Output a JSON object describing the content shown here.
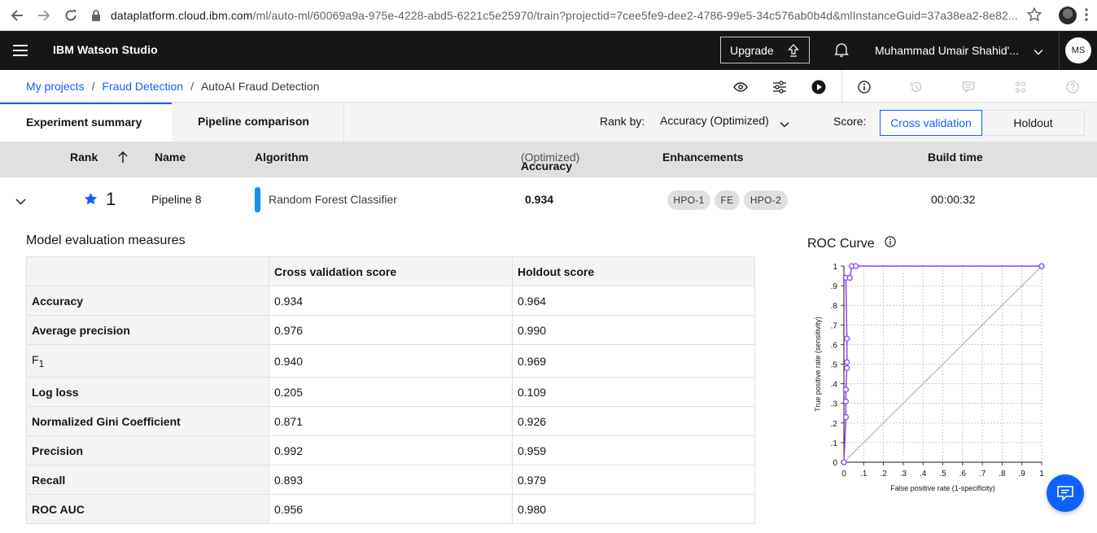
{
  "browser": {
    "url_host": "dataplatform.cloud.ibm.com",
    "url_path": "/ml/auto-ml/60069a9a-975e-4228-abd5-6221c5e25970/train?projectid=7cee5fe9-dee2-4786-99e5-34c576ab0b4d&mlInstanceGuid=37a38ea2-8e82..."
  },
  "header": {
    "product": "IBM Watson Studio",
    "upgrade_label": "Upgrade",
    "user_name": "Muhammad Umair Shahid'...",
    "avatar_initials": "MS"
  },
  "breadcrumb": {
    "items": [
      "My projects",
      "Fraud Detection"
    ],
    "current": "AutoAI Fraud Detection",
    "separator": "/"
  },
  "tabs": {
    "active": "Experiment summary",
    "inactive": "Pipeline comparison"
  },
  "rank_by": {
    "label": "Rank by:",
    "value": "Accuracy (Optimized)"
  },
  "score": {
    "label": "Score:",
    "options": [
      "Cross validation",
      "Holdout"
    ],
    "selected": "Cross validation"
  },
  "columns": {
    "rank": "Rank",
    "name": "Name",
    "algorithm": "Algorithm",
    "metric": "Accuracy",
    "metric_note": "(Optimized)",
    "enhancements": "Enhancements",
    "build_time": "Build time"
  },
  "pipeline": {
    "rank": "1",
    "name": "Pipeline 8",
    "algorithm": "Random Forest Classifier",
    "accuracy": "0.934",
    "enhancements": [
      "HPO-1",
      "FE",
      "HPO-2"
    ],
    "build_time": "00:00:32",
    "accent_color": "#1192e8"
  },
  "evaluation": {
    "title": "Model evaluation measures",
    "headers": [
      "Cross validation score",
      "Holdout score"
    ],
    "rows": [
      {
        "metric": "Accuracy",
        "cv": "0.934",
        "holdout": "0.964"
      },
      {
        "metric": "Average precision",
        "cv": "0.976",
        "holdout": "0.990"
      },
      {
        "metric": "F",
        "sub": "1",
        "cv": "0.940",
        "holdout": "0.969"
      },
      {
        "metric": "Log loss",
        "cv": "0.205",
        "holdout": "0.109"
      },
      {
        "metric": "Normalized Gini Coefficient",
        "cv": "0.871",
        "holdout": "0.926"
      },
      {
        "metric": "Precision",
        "cv": "0.992",
        "holdout": "0.959"
      },
      {
        "metric": "Recall",
        "cv": "0.893",
        "holdout": "0.979"
      },
      {
        "metric": "ROC AUC",
        "cv": "0.956",
        "holdout": "0.980"
      }
    ]
  },
  "roc": {
    "title": "ROC Curve",
    "color": "#8a3ffc"
  },
  "chart_data": {
    "type": "line",
    "title": "ROC Curve",
    "xlabel": "False positive rate (1-specificity)",
    "ylabel": "True positive rate (sensitivity)",
    "xlim": [
      0,
      1
    ],
    "ylim": [
      0,
      1
    ],
    "x_ticks": [
      "0",
      ".1",
      ".2",
      ".3",
      ".4",
      ".5",
      ".6",
      ".7",
      ".8",
      ".9",
      "1"
    ],
    "y_ticks": [
      "0",
      ".1",
      ".2",
      ".3",
      ".4",
      ".5",
      ".6",
      ".7",
      ".8",
      ".9",
      "1"
    ],
    "grid": true,
    "series": [
      {
        "points": [
          [
            0,
            0
          ],
          [
            0.01,
            0.23
          ],
          [
            0.01,
            0.31
          ],
          [
            0.01,
            0.37
          ],
          [
            0.015,
            0.48
          ],
          [
            0.015,
            0.51
          ],
          [
            0.015,
            0.63
          ],
          [
            0.01,
            0.94
          ],
          [
            0.03,
            0.94
          ],
          [
            0.04,
            1.0
          ],
          [
            0.06,
            1.0
          ],
          [
            1.0,
            1.0
          ]
        ]
      },
      {
        "points": [
          [
            0,
            0
          ],
          [
            1,
            1
          ]
        ]
      }
    ]
  }
}
